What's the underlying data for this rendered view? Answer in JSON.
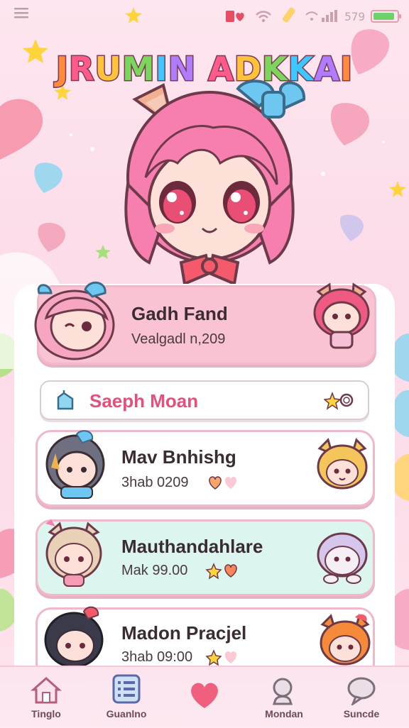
{
  "status_bar": {
    "menu_icon": "hamburger-icon",
    "icons": [
      "heart-icon",
      "wifi-icon",
      "signal-icon"
    ],
    "time": "579",
    "battery_level": 0.9
  },
  "app": {
    "title": "JRUMIN ADKKAI"
  },
  "featured": {
    "name": "Gadh Fand",
    "sub": "Vealgadl n,209"
  },
  "search": {
    "value": "Saeph Moan"
  },
  "list": [
    {
      "name": "Mav Bnhishg",
      "sub": "3hab 0209"
    },
    {
      "name": "Mauthandahlare",
      "sub": "Mak 99.00"
    },
    {
      "name": "Madon Pracjel",
      "sub": "3hab 09:00"
    }
  ],
  "nav": [
    {
      "label": "Tinglo",
      "icon": "home-icon"
    },
    {
      "label": "Guanlno",
      "icon": "list-icon"
    },
    {
      "label": "",
      "icon": "heart-icon"
    },
    {
      "label": "Mondan",
      "icon": "search-icon"
    },
    {
      "label": "Suncde",
      "icon": "chat-bubble-icon"
    }
  ],
  "colors": {
    "accent": "#e4507a",
    "featured_bg": "#f9c3d3",
    "teal_bg": "#dcf6ef",
    "title_colors": [
      "#ff8a3d",
      "#ff5a8a",
      "#ffc23d",
      "#7ad65c",
      "#3dc6ff",
      "#b07cff"
    ]
  }
}
